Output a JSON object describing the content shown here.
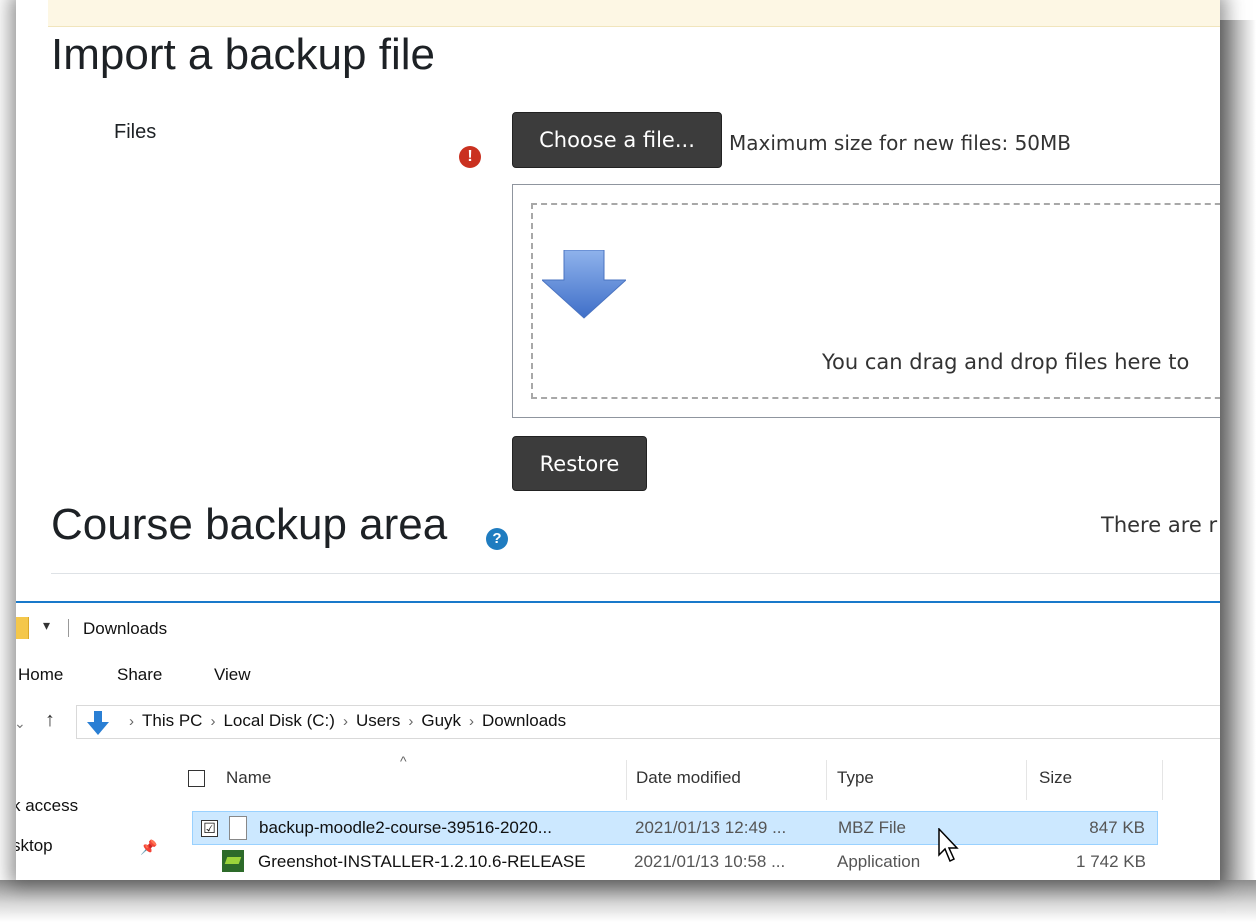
{
  "moodle": {
    "title": "Import a backup file",
    "files_label": "Files",
    "required_icon": "!",
    "choose_file_label": "Choose a file...",
    "max_size_text": "Maximum size for new files: 50MB",
    "drop_text": "You can drag and drop files here to",
    "restore_label": "Restore",
    "course_backup_title": "Course backup area",
    "help_icon": "?",
    "there_are_text": "There are r"
  },
  "explorer": {
    "window_title": "Downloads",
    "dropdown_glyph": "▾",
    "ribbon_tabs": [
      "Home",
      "Share",
      "View"
    ],
    "nav_back_glyph": "⌄",
    "nav_up_glyph": "↑",
    "breadcrumbs": [
      "This PC",
      "Local Disk (C:)",
      "Users",
      "Guyk",
      "Downloads"
    ],
    "breadcrumb_separator": "›",
    "sidebar_items": [
      "k access",
      "sktop"
    ],
    "sort_caret": "^",
    "pin_glyph": "📌",
    "columns": {
      "name": "Name",
      "date_modified": "Date modified",
      "type": "Type",
      "size": "Size"
    },
    "rows": [
      {
        "name": "backup-moodle2-course-39516-2020...",
        "date": "2021/01/13 12:49 ...",
        "type": "MBZ File",
        "size": "847 KB",
        "checked": "☑",
        "icon": "file-icon"
      },
      {
        "name": "Greenshot-INSTALLER-1.2.10.6-RELEASE",
        "date": "2021/01/13 10:58 ...",
        "type": "Application",
        "size": "1 742 KB",
        "icon": "greenshot-app-icon"
      }
    ]
  },
  "colors": {
    "button_bg": "#3c3c3c",
    "error_red": "#ca3120",
    "help_blue": "#1f7cc0",
    "selection_bg": "#cce8ff",
    "explorer_accent": "#1979ca"
  }
}
